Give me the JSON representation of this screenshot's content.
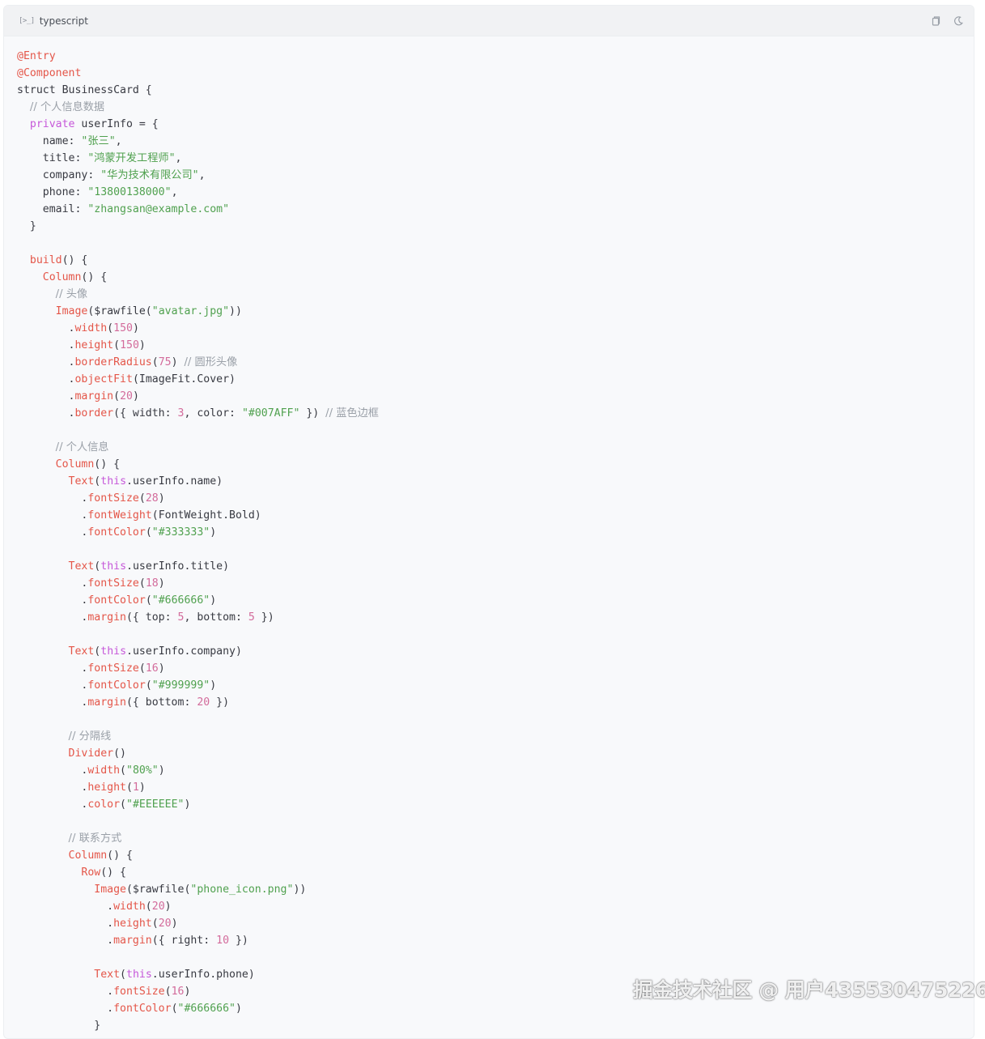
{
  "code_block": {
    "lang_icon": "[>_]",
    "language": "typescript",
    "actions": [
      {
        "name": "copy-icon"
      },
      {
        "name": "theme-toggle-icon"
      }
    ]
  },
  "code_lines": [
    [
      [
        "fn",
        "@Entry"
      ]
    ],
    [
      [
        "fn",
        "@Component"
      ]
    ],
    [
      [
        "pl",
        "struct BusinessCard {"
      ]
    ],
    [
      [
        "pl",
        "  "
      ],
      [
        "com",
        "// 个人信息数据"
      ]
    ],
    [
      [
        "pl",
        "  "
      ],
      [
        "kw",
        "private"
      ],
      [
        "pl",
        " userInfo = {"
      ]
    ],
    [
      [
        "pl",
        "    name: "
      ],
      [
        "str",
        "\"张三\""
      ],
      [
        "pl",
        ","
      ]
    ],
    [
      [
        "pl",
        "    title: "
      ],
      [
        "str",
        "\"鸿蒙开发工程师\""
      ],
      [
        "pl",
        ","
      ]
    ],
    [
      [
        "pl",
        "    company: "
      ],
      [
        "str",
        "\"华为技术有限公司\""
      ],
      [
        "pl",
        ","
      ]
    ],
    [
      [
        "pl",
        "    phone: "
      ],
      [
        "str",
        "\"13800138000\""
      ],
      [
        "pl",
        ","
      ]
    ],
    [
      [
        "pl",
        "    email: "
      ],
      [
        "str",
        "\"zhangsan@example.com\""
      ]
    ],
    [
      [
        "pl",
        "  }"
      ]
    ],
    [
      [
        "pl",
        ""
      ]
    ],
    [
      [
        "pl",
        "  "
      ],
      [
        "fn",
        "build"
      ],
      [
        "pl",
        "() {"
      ]
    ],
    [
      [
        "pl",
        "    "
      ],
      [
        "fn",
        "Column"
      ],
      [
        "pl",
        "() {"
      ]
    ],
    [
      [
        "pl",
        "      "
      ],
      [
        "com",
        "// 头像"
      ]
    ],
    [
      [
        "pl",
        "      "
      ],
      [
        "fn",
        "Image"
      ],
      [
        "pl",
        "($rawfile("
      ],
      [
        "str",
        "\"avatar.jpg\""
      ],
      [
        "pl",
        "))"
      ]
    ],
    [
      [
        "pl",
        "        ."
      ],
      [
        "fn",
        "width"
      ],
      [
        "pl",
        "("
      ],
      [
        "num",
        "150"
      ],
      [
        "pl",
        ")"
      ]
    ],
    [
      [
        "pl",
        "        ."
      ],
      [
        "fn",
        "height"
      ],
      [
        "pl",
        "("
      ],
      [
        "num",
        "150"
      ],
      [
        "pl",
        ")"
      ]
    ],
    [
      [
        "pl",
        "        ."
      ],
      [
        "fn",
        "borderRadius"
      ],
      [
        "pl",
        "("
      ],
      [
        "num",
        "75"
      ],
      [
        "pl",
        ") "
      ],
      [
        "com",
        "// 圆形头像"
      ]
    ],
    [
      [
        "pl",
        "        ."
      ],
      [
        "fn",
        "objectFit"
      ],
      [
        "pl",
        "(ImageFit.Cover)"
      ]
    ],
    [
      [
        "pl",
        "        ."
      ],
      [
        "fn",
        "margin"
      ],
      [
        "pl",
        "("
      ],
      [
        "num",
        "20"
      ],
      [
        "pl",
        ")"
      ]
    ],
    [
      [
        "pl",
        "        ."
      ],
      [
        "fn",
        "border"
      ],
      [
        "pl",
        "({ width: "
      ],
      [
        "num",
        "3"
      ],
      [
        "pl",
        ", color: "
      ],
      [
        "str",
        "\"#007AFF\""
      ],
      [
        "pl",
        " }) "
      ],
      [
        "com",
        "// 蓝色边框"
      ]
    ],
    [
      [
        "pl",
        ""
      ]
    ],
    [
      [
        "pl",
        "      "
      ],
      [
        "com",
        "// 个人信息"
      ]
    ],
    [
      [
        "pl",
        "      "
      ],
      [
        "fn",
        "Column"
      ],
      [
        "pl",
        "() {"
      ]
    ],
    [
      [
        "pl",
        "        "
      ],
      [
        "fn",
        "Text"
      ],
      [
        "pl",
        "("
      ],
      [
        "kw",
        "this"
      ],
      [
        "pl",
        ".userInfo.name)"
      ]
    ],
    [
      [
        "pl",
        "          ."
      ],
      [
        "fn",
        "fontSize"
      ],
      [
        "pl",
        "("
      ],
      [
        "num",
        "28"
      ],
      [
        "pl",
        ")"
      ]
    ],
    [
      [
        "pl",
        "          ."
      ],
      [
        "fn",
        "fontWeight"
      ],
      [
        "pl",
        "(FontWeight.Bold)"
      ]
    ],
    [
      [
        "pl",
        "          ."
      ],
      [
        "fn",
        "fontColor"
      ],
      [
        "pl",
        "("
      ],
      [
        "str",
        "\"#333333\""
      ],
      [
        "pl",
        ")"
      ]
    ],
    [
      [
        "pl",
        ""
      ]
    ],
    [
      [
        "pl",
        "        "
      ],
      [
        "fn",
        "Text"
      ],
      [
        "pl",
        "("
      ],
      [
        "kw",
        "this"
      ],
      [
        "pl",
        ".userInfo.title)"
      ]
    ],
    [
      [
        "pl",
        "          ."
      ],
      [
        "fn",
        "fontSize"
      ],
      [
        "pl",
        "("
      ],
      [
        "num",
        "18"
      ],
      [
        "pl",
        ")"
      ]
    ],
    [
      [
        "pl",
        "          ."
      ],
      [
        "fn",
        "fontColor"
      ],
      [
        "pl",
        "("
      ],
      [
        "str",
        "\"#666666\""
      ],
      [
        "pl",
        ")"
      ]
    ],
    [
      [
        "pl",
        "          ."
      ],
      [
        "fn",
        "margin"
      ],
      [
        "pl",
        "({ top: "
      ],
      [
        "num",
        "5"
      ],
      [
        "pl",
        ", bottom: "
      ],
      [
        "num",
        "5"
      ],
      [
        "pl",
        " })"
      ]
    ],
    [
      [
        "pl",
        ""
      ]
    ],
    [
      [
        "pl",
        "        "
      ],
      [
        "fn",
        "Text"
      ],
      [
        "pl",
        "("
      ],
      [
        "kw",
        "this"
      ],
      [
        "pl",
        ".userInfo.company)"
      ]
    ],
    [
      [
        "pl",
        "          ."
      ],
      [
        "fn",
        "fontSize"
      ],
      [
        "pl",
        "("
      ],
      [
        "num",
        "16"
      ],
      [
        "pl",
        ")"
      ]
    ],
    [
      [
        "pl",
        "          ."
      ],
      [
        "fn",
        "fontColor"
      ],
      [
        "pl",
        "("
      ],
      [
        "str",
        "\"#999999\""
      ],
      [
        "pl",
        ")"
      ]
    ],
    [
      [
        "pl",
        "          ."
      ],
      [
        "fn",
        "margin"
      ],
      [
        "pl",
        "({ bottom: "
      ],
      [
        "num",
        "20"
      ],
      [
        "pl",
        " })"
      ]
    ],
    [
      [
        "pl",
        ""
      ]
    ],
    [
      [
        "pl",
        "        "
      ],
      [
        "com",
        "// 分隔线"
      ]
    ],
    [
      [
        "pl",
        "        "
      ],
      [
        "fn",
        "Divider"
      ],
      [
        "pl",
        "()"
      ]
    ],
    [
      [
        "pl",
        "          ."
      ],
      [
        "fn",
        "width"
      ],
      [
        "pl",
        "("
      ],
      [
        "str",
        "\"80%\""
      ],
      [
        "pl",
        ")"
      ]
    ],
    [
      [
        "pl",
        "          ."
      ],
      [
        "fn",
        "height"
      ],
      [
        "pl",
        "("
      ],
      [
        "num",
        "1"
      ],
      [
        "pl",
        ")"
      ]
    ],
    [
      [
        "pl",
        "          ."
      ],
      [
        "fn",
        "color"
      ],
      [
        "pl",
        "("
      ],
      [
        "str",
        "\"#EEEEEE\""
      ],
      [
        "pl",
        ")"
      ]
    ],
    [
      [
        "pl",
        ""
      ]
    ],
    [
      [
        "pl",
        "        "
      ],
      [
        "com",
        "// 联系方式"
      ]
    ],
    [
      [
        "pl",
        "        "
      ],
      [
        "fn",
        "Column"
      ],
      [
        "pl",
        "() {"
      ]
    ],
    [
      [
        "pl",
        "          "
      ],
      [
        "fn",
        "Row"
      ],
      [
        "pl",
        "() {"
      ]
    ],
    [
      [
        "pl",
        "            "
      ],
      [
        "fn",
        "Image"
      ],
      [
        "pl",
        "($rawfile("
      ],
      [
        "str",
        "\"phone_icon.png\""
      ],
      [
        "pl",
        "))"
      ]
    ],
    [
      [
        "pl",
        "              ."
      ],
      [
        "fn",
        "width"
      ],
      [
        "pl",
        "("
      ],
      [
        "num",
        "20"
      ],
      [
        "pl",
        ")"
      ]
    ],
    [
      [
        "pl",
        "              ."
      ],
      [
        "fn",
        "height"
      ],
      [
        "pl",
        "("
      ],
      [
        "num",
        "20"
      ],
      [
        "pl",
        ")"
      ]
    ],
    [
      [
        "pl",
        "              ."
      ],
      [
        "fn",
        "margin"
      ],
      [
        "pl",
        "({ right: "
      ],
      [
        "num",
        "10"
      ],
      [
        "pl",
        " })"
      ]
    ],
    [
      [
        "pl",
        ""
      ]
    ],
    [
      [
        "pl",
        "            "
      ],
      [
        "fn",
        "Text"
      ],
      [
        "pl",
        "("
      ],
      [
        "kw",
        "this"
      ],
      [
        "pl",
        ".userInfo.phone)"
      ]
    ],
    [
      [
        "pl",
        "              ."
      ],
      [
        "fn",
        "fontSize"
      ],
      [
        "pl",
        "("
      ],
      [
        "num",
        "16"
      ],
      [
        "pl",
        ")"
      ]
    ],
    [
      [
        "pl",
        "              ."
      ],
      [
        "fn",
        "fontColor"
      ],
      [
        "pl",
        "("
      ],
      [
        "str",
        "\"#666666\""
      ],
      [
        "pl",
        ")"
      ]
    ],
    [
      [
        "pl",
        "            }"
      ]
    ]
  ],
  "watermark": "掘金技术社区 @ 用户435530475226",
  "colors": {
    "keyword": "#c658d9",
    "function": "#e45649",
    "string": "#50a14f",
    "number": "#d36b9b",
    "comment": "#9aa0a8",
    "plain": "#383a42"
  }
}
